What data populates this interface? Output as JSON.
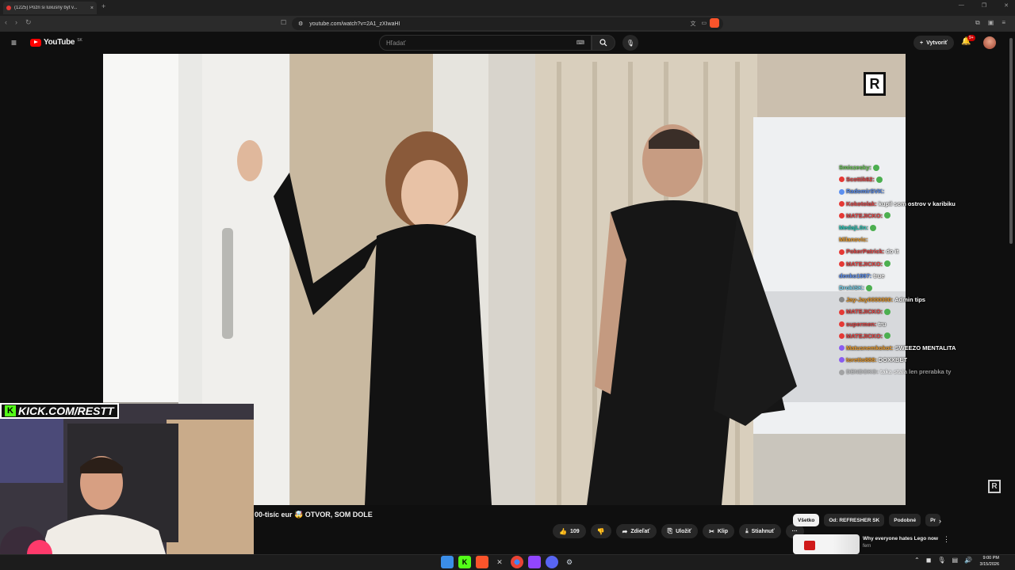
{
  "browser": {
    "tab_title": "(1225) Pozri si luxusný byt v...",
    "tab_close": "×",
    "new_tab": "+",
    "url": "youtube.com/watch?v=2A1_zXIwaHI",
    "window_controls": [
      "—",
      "❐",
      "✕"
    ]
  },
  "youtube": {
    "logo_text": "YouTube",
    "country": "SK",
    "search_placeholder": "Hľadať",
    "create_label": "Vytvoriť",
    "notification_count": "9+"
  },
  "stream": {
    "kick_label": "KICK.COM/RESTT",
    "kick_logo": "K"
  },
  "chat": [
    {
      "user": "Smiczesky:",
      "msg": "",
      "color": "#6fd15a",
      "badge": "",
      "emote": true
    },
    {
      "user": "Scottik62:",
      "msg": "",
      "color": "#e94949",
      "badge": "#e53935",
      "emote": true
    },
    {
      "user": "RadomirSVK:",
      "msg": "",
      "color": "#5b8ff0",
      "badge": "#5b8ff0",
      "emote": false
    },
    {
      "user": "Kokotolak:",
      "msg": "kupil som ostrov v karibiku",
      "color": "#e94949",
      "badge": "#e53935",
      "emote": false
    },
    {
      "user": "MATEJICKO:",
      "msg": "",
      "color": "#e94949",
      "badge": "#e53935",
      "emote": true
    },
    {
      "user": "MedajL0n:",
      "msg": "",
      "color": "#2fd1c0",
      "badge": "",
      "emote": true
    },
    {
      "user": "Milanovic:",
      "msg": "",
      "color": "#f0a030",
      "badge": "",
      "emote": false
    },
    {
      "user": "PokerPatrick:",
      "msg": "do it",
      "color": "#e94949",
      "badge": "#e53935",
      "emote": false
    },
    {
      "user": "MATEJICKO:",
      "msg": "",
      "color": "#e94949",
      "badge": "#e53935",
      "emote": true
    },
    {
      "user": "denko1997:",
      "msg": "true",
      "color": "#5b8ff0",
      "badge": "",
      "emote": false
    },
    {
      "user": "DrokiSK:",
      "msg": "",
      "color": "#7ad7f0",
      "badge": "",
      "emote": true
    },
    {
      "user": "Jay-Jay0000000:",
      "msg": "Admin tips",
      "color": "#f0a030",
      "badge": "#888888",
      "emote": false
    },
    {
      "user": "MATEJICKO:",
      "msg": "",
      "color": "#e94949",
      "badge": "#e53935",
      "emote": true
    },
    {
      "user": "supermen:",
      "msg": "tru",
      "color": "#e94949",
      "badge": "#e53935",
      "emote": false
    },
    {
      "user": "MATEJICKO:",
      "msg": "",
      "color": "#e94949",
      "badge": "#e53935",
      "emote": true
    },
    {
      "user": "Matusnemkokot:",
      "msg": "SWEEZO MENTALITA",
      "color": "#f0a030",
      "badge": "#8a5cf0",
      "emote": false
    },
    {
      "user": "toretto888:",
      "msg": "DOXXBET",
      "color": "#f0a030",
      "badge": "#8a5cf0",
      "emote": false
    },
    {
      "user": "DENDOKO:",
      "msg": "taka stala len prerabka ty",
      "color": "#9a9a9a",
      "badge": "#777777",
      "emote": false
    }
  ],
  "video": {
    "title_fragment": "00-tisíc eur 🤯 OTVOR, SOM DOLE",
    "watermark": "R"
  },
  "actions": {
    "like_count": "109",
    "share": "Zdieľať",
    "save": "Uložiť",
    "clip": "Klip",
    "download": "Stiahnuť",
    "more": "···"
  },
  "filters": [
    "Všetko",
    "Od: REFRESHER SK",
    "Podobné",
    "Pr"
  ],
  "recommendation": {
    "title": "Why everyone hates Lego now",
    "channel": "fern"
  },
  "taskbar": {
    "time": "9:00 PM",
    "date": "3/15/2026"
  },
  "colors": {
    "youtube_red": "#ff0000",
    "kick_green": "#53fc18",
    "background": "#0f0f0f"
  }
}
